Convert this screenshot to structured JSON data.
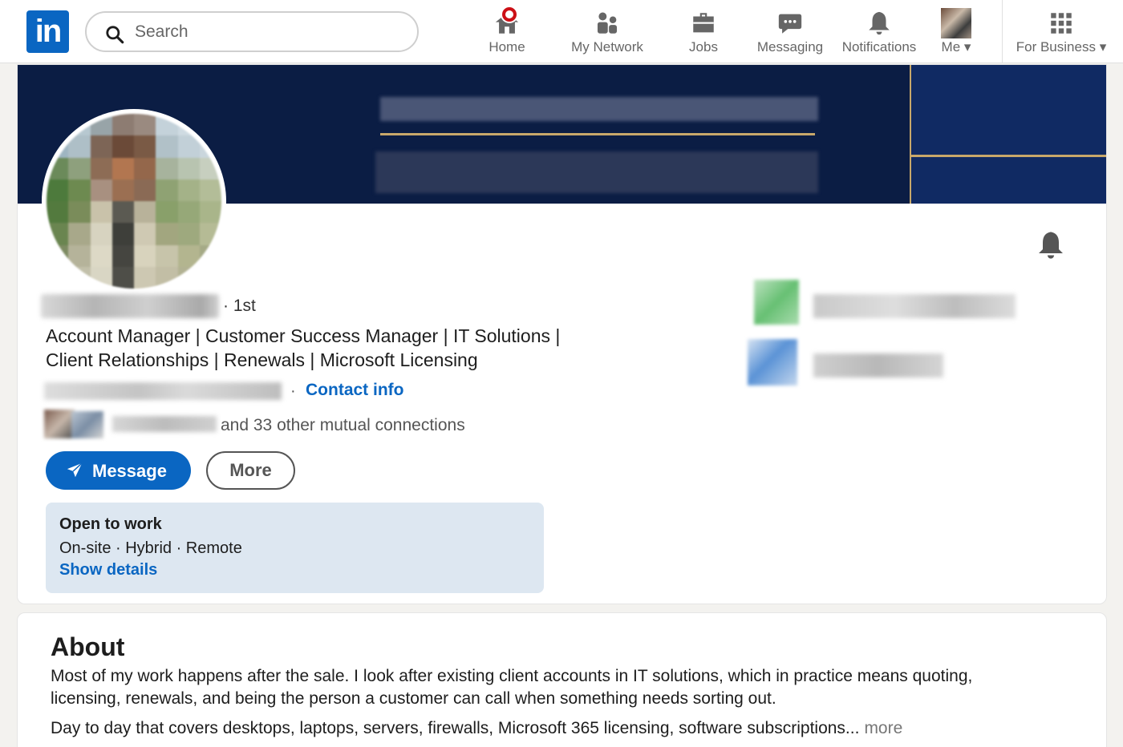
{
  "nav": {
    "search_placeholder": "Search",
    "items": [
      {
        "label": "Home",
        "icon": "home-icon"
      },
      {
        "label": "My Network",
        "icon": "network-icon"
      },
      {
        "label": "Jobs",
        "icon": "briefcase-icon"
      },
      {
        "label": "Messaging",
        "icon": "chat-icon"
      },
      {
        "label": "Notifications",
        "icon": "bell-icon"
      },
      {
        "label": "Me",
        "icon": "avatar"
      },
      {
        "label": "For Business",
        "icon": "grid-icon"
      }
    ]
  },
  "profile": {
    "degree": "· 1st",
    "headline": "Account Manager | Customer Success Manager | IT Solutions | Client Relationships | Renewals | Microsoft Licensing",
    "dot": "·",
    "contact_info": "Contact info",
    "mutual_text": "and 33 other mutual connections",
    "message_button": "Message",
    "more_button": "More"
  },
  "open_to_work": {
    "title": "Open to work",
    "subtitle": "On-site · Hybrid · Remote",
    "link": "Show details"
  },
  "about": {
    "title": "About",
    "para1": "Most of my work happens after the sale. I look after existing client accounts in IT solutions, which in practice means quoting, licensing, renewals, and being the person a customer can call when something needs sorting out.",
    "para2": "Day to day that covers desktops, laptops, servers, firewalls, Microsoft 365 licensing, software subscriptions...",
    "more": "more"
  },
  "colors": {
    "brand": "#0a66c2",
    "banner": "#0b1d44",
    "notification_badge": "#cc1016",
    "open_to_work_bg": "#dde7f1"
  }
}
